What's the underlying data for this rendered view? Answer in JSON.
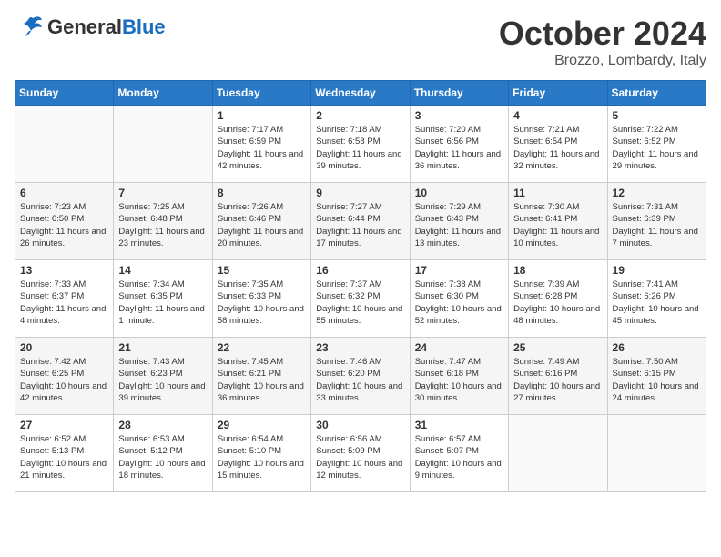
{
  "header": {
    "logo_general": "General",
    "logo_blue": "Blue",
    "month": "October 2024",
    "location": "Brozzo, Lombardy, Italy"
  },
  "days_of_week": [
    "Sunday",
    "Monday",
    "Tuesday",
    "Wednesday",
    "Thursday",
    "Friday",
    "Saturday"
  ],
  "weeks": [
    [
      {
        "day": "",
        "content": ""
      },
      {
        "day": "",
        "content": ""
      },
      {
        "day": "1",
        "content": "Sunrise: 7:17 AM\nSunset: 6:59 PM\nDaylight: 11 hours and 42 minutes."
      },
      {
        "day": "2",
        "content": "Sunrise: 7:18 AM\nSunset: 6:58 PM\nDaylight: 11 hours and 39 minutes."
      },
      {
        "day": "3",
        "content": "Sunrise: 7:20 AM\nSunset: 6:56 PM\nDaylight: 11 hours and 36 minutes."
      },
      {
        "day": "4",
        "content": "Sunrise: 7:21 AM\nSunset: 6:54 PM\nDaylight: 11 hours and 32 minutes."
      },
      {
        "day": "5",
        "content": "Sunrise: 7:22 AM\nSunset: 6:52 PM\nDaylight: 11 hours and 29 minutes."
      }
    ],
    [
      {
        "day": "6",
        "content": "Sunrise: 7:23 AM\nSunset: 6:50 PM\nDaylight: 11 hours and 26 minutes."
      },
      {
        "day": "7",
        "content": "Sunrise: 7:25 AM\nSunset: 6:48 PM\nDaylight: 11 hours and 23 minutes."
      },
      {
        "day": "8",
        "content": "Sunrise: 7:26 AM\nSunset: 6:46 PM\nDaylight: 11 hours and 20 minutes."
      },
      {
        "day": "9",
        "content": "Sunrise: 7:27 AM\nSunset: 6:44 PM\nDaylight: 11 hours and 17 minutes."
      },
      {
        "day": "10",
        "content": "Sunrise: 7:29 AM\nSunset: 6:43 PM\nDaylight: 11 hours and 13 minutes."
      },
      {
        "day": "11",
        "content": "Sunrise: 7:30 AM\nSunset: 6:41 PM\nDaylight: 11 hours and 10 minutes."
      },
      {
        "day": "12",
        "content": "Sunrise: 7:31 AM\nSunset: 6:39 PM\nDaylight: 11 hours and 7 minutes."
      }
    ],
    [
      {
        "day": "13",
        "content": "Sunrise: 7:33 AM\nSunset: 6:37 PM\nDaylight: 11 hours and 4 minutes."
      },
      {
        "day": "14",
        "content": "Sunrise: 7:34 AM\nSunset: 6:35 PM\nDaylight: 11 hours and 1 minute."
      },
      {
        "day": "15",
        "content": "Sunrise: 7:35 AM\nSunset: 6:33 PM\nDaylight: 10 hours and 58 minutes."
      },
      {
        "day": "16",
        "content": "Sunrise: 7:37 AM\nSunset: 6:32 PM\nDaylight: 10 hours and 55 minutes."
      },
      {
        "day": "17",
        "content": "Sunrise: 7:38 AM\nSunset: 6:30 PM\nDaylight: 10 hours and 52 minutes."
      },
      {
        "day": "18",
        "content": "Sunrise: 7:39 AM\nSunset: 6:28 PM\nDaylight: 10 hours and 48 minutes."
      },
      {
        "day": "19",
        "content": "Sunrise: 7:41 AM\nSunset: 6:26 PM\nDaylight: 10 hours and 45 minutes."
      }
    ],
    [
      {
        "day": "20",
        "content": "Sunrise: 7:42 AM\nSunset: 6:25 PM\nDaylight: 10 hours and 42 minutes."
      },
      {
        "day": "21",
        "content": "Sunrise: 7:43 AM\nSunset: 6:23 PM\nDaylight: 10 hours and 39 minutes."
      },
      {
        "day": "22",
        "content": "Sunrise: 7:45 AM\nSunset: 6:21 PM\nDaylight: 10 hours and 36 minutes."
      },
      {
        "day": "23",
        "content": "Sunrise: 7:46 AM\nSunset: 6:20 PM\nDaylight: 10 hours and 33 minutes."
      },
      {
        "day": "24",
        "content": "Sunrise: 7:47 AM\nSunset: 6:18 PM\nDaylight: 10 hours and 30 minutes."
      },
      {
        "day": "25",
        "content": "Sunrise: 7:49 AM\nSunset: 6:16 PM\nDaylight: 10 hours and 27 minutes."
      },
      {
        "day": "26",
        "content": "Sunrise: 7:50 AM\nSunset: 6:15 PM\nDaylight: 10 hours and 24 minutes."
      }
    ],
    [
      {
        "day": "27",
        "content": "Sunrise: 6:52 AM\nSunset: 5:13 PM\nDaylight: 10 hours and 21 minutes."
      },
      {
        "day": "28",
        "content": "Sunrise: 6:53 AM\nSunset: 5:12 PM\nDaylight: 10 hours and 18 minutes."
      },
      {
        "day": "29",
        "content": "Sunrise: 6:54 AM\nSunset: 5:10 PM\nDaylight: 10 hours and 15 minutes."
      },
      {
        "day": "30",
        "content": "Sunrise: 6:56 AM\nSunset: 5:09 PM\nDaylight: 10 hours and 12 minutes."
      },
      {
        "day": "31",
        "content": "Sunrise: 6:57 AM\nSunset: 5:07 PM\nDaylight: 10 hours and 9 minutes."
      },
      {
        "day": "",
        "content": ""
      },
      {
        "day": "",
        "content": ""
      }
    ]
  ]
}
